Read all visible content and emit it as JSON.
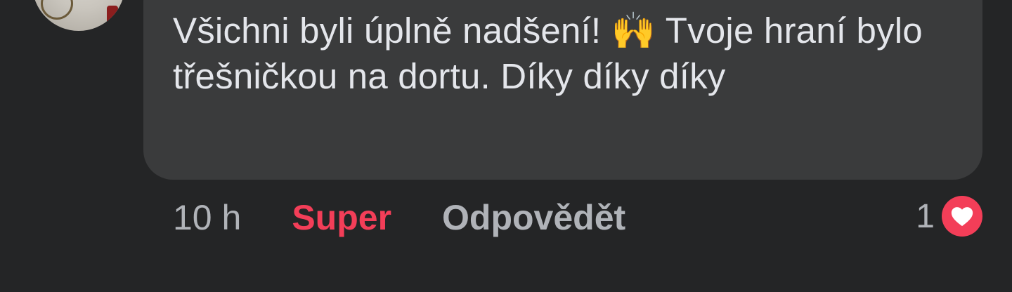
{
  "comment": {
    "text": "Všichni byli úplně nadšení! 🙌 Tvoje hraní bylo třešničkou na dortu. Díky díky díky",
    "time": "10 h",
    "reaction_label": "Super",
    "reply_label": "Odpovědět",
    "reaction_count": "1",
    "reaction_icon": "heart-icon"
  },
  "colors": {
    "background": "#242526",
    "bubble": "#3a3b3c",
    "text": "#e4e6eb",
    "muted": "#b0b3b8",
    "accent": "#f33e58"
  }
}
